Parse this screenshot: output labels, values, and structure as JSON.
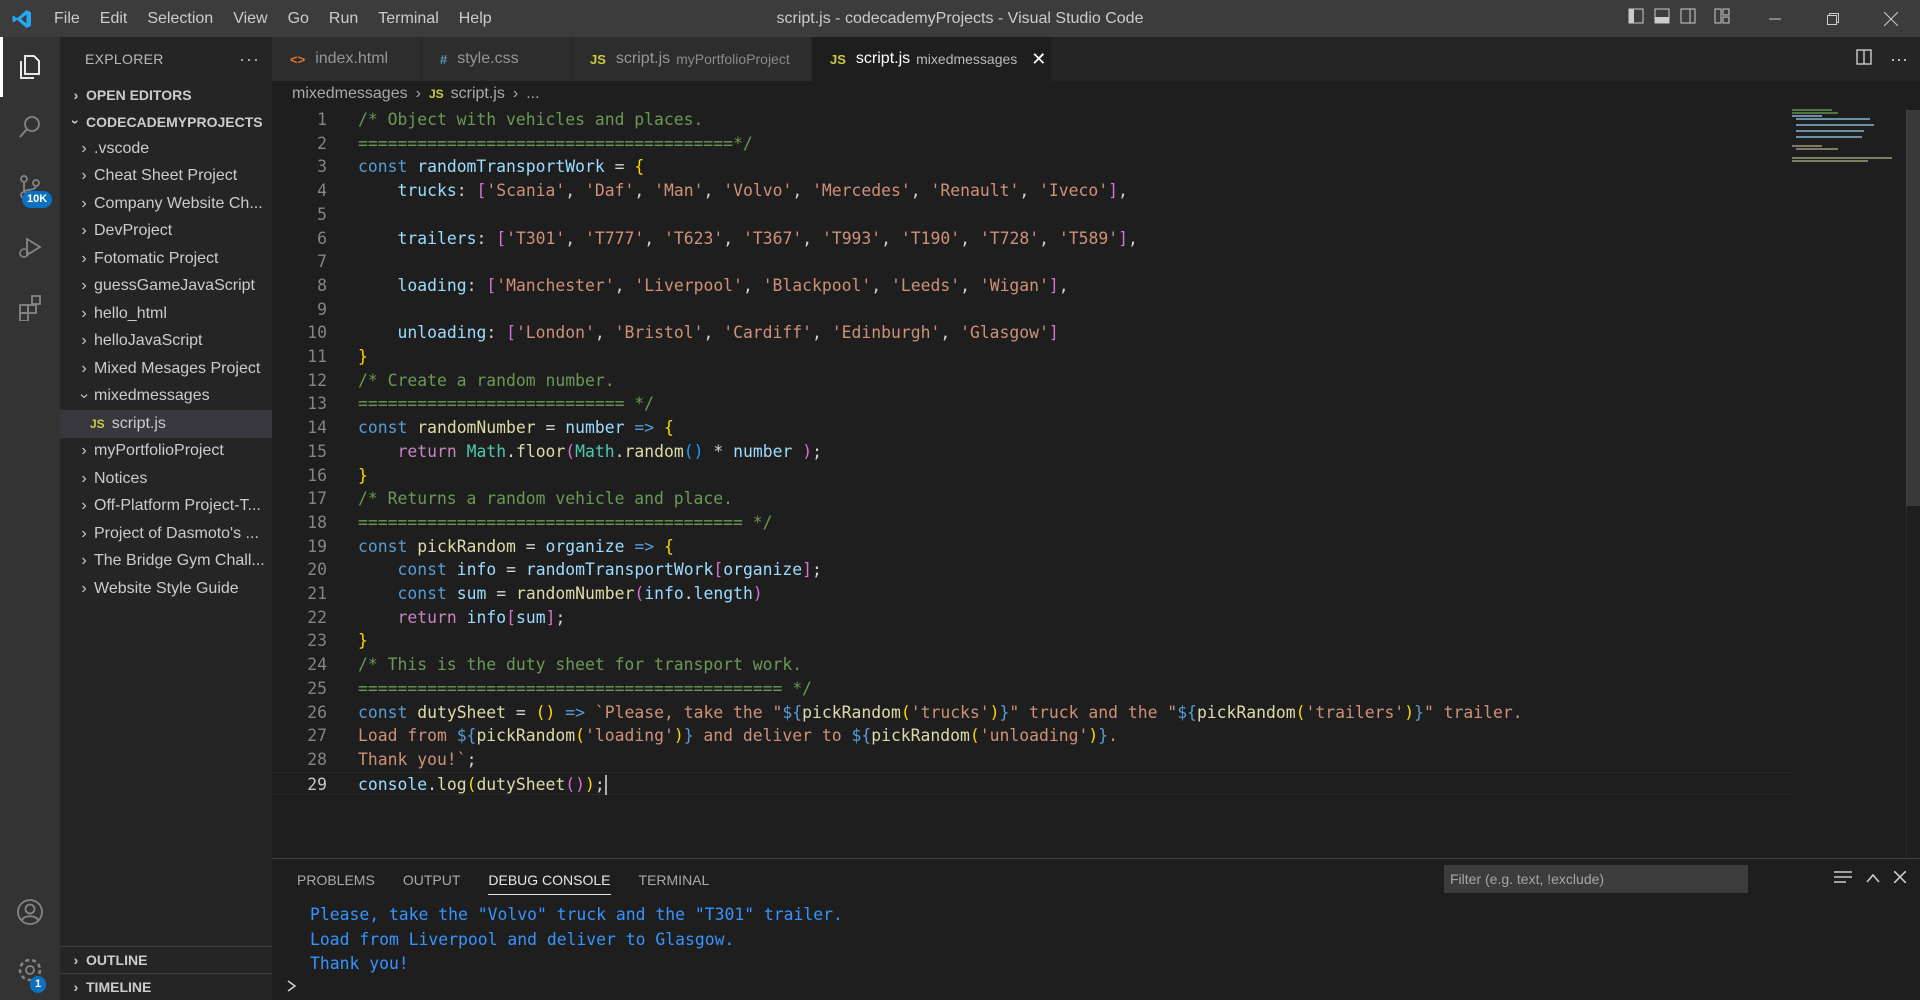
{
  "window": {
    "title": "script.js - codecademyProjects - Visual Studio Code"
  },
  "menu": [
    "File",
    "Edit",
    "Selection",
    "View",
    "Go",
    "Run",
    "Terminal",
    "Help"
  ],
  "activity": {
    "scm_badge": "10K",
    "settings_badge": "1"
  },
  "sidebar": {
    "title": "EXPLORER",
    "open_editors": "OPEN EDITORS",
    "root": "CODECADEMYPROJECTS",
    "items": [
      {
        "label": ".vscode",
        "type": "folder"
      },
      {
        "label": "Cheat Sheet Project",
        "type": "folder"
      },
      {
        "label": "Company Website Ch...",
        "type": "folder"
      },
      {
        "label": "DevProject",
        "type": "folder"
      },
      {
        "label": "Fotomatic Project",
        "type": "folder"
      },
      {
        "label": "guessGameJavaScript",
        "type": "folder"
      },
      {
        "label": "hello_html",
        "type": "folder"
      },
      {
        "label": "helloJavaScript",
        "type": "folder"
      },
      {
        "label": "Mixed Mesages Project",
        "type": "folder"
      },
      {
        "label": "mixedmessages",
        "type": "folder-open"
      },
      {
        "label": "script.js",
        "type": "file"
      },
      {
        "label": "myPortfolioProject",
        "type": "folder"
      },
      {
        "label": "Notices",
        "type": "folder"
      },
      {
        "label": "Off-Platform Project-T...",
        "type": "folder"
      },
      {
        "label": "Project of Dasmoto's ...",
        "type": "folder"
      },
      {
        "label": "The Bridge Gym Chall...",
        "type": "folder"
      },
      {
        "label": "Website Style Guide",
        "type": "folder"
      }
    ],
    "outline": "OUTLINE",
    "timeline": "TIMELINE"
  },
  "tabs": [
    {
      "label": "index.html",
      "desc": "",
      "icon": "<>",
      "icon_color": "#e37933"
    },
    {
      "label": "style.css",
      "desc": "",
      "icon": "#",
      "icon_color": "#519aba"
    },
    {
      "label": "script.js",
      "desc": "myPortfolioProject",
      "icon": "JS",
      "icon_color": "#cbcb41"
    },
    {
      "label": "script.js",
      "desc": "mixedmessages",
      "icon": "JS",
      "icon_color": "#cbcb41"
    }
  ],
  "breadcrumb": {
    "folder": "mixedmessages",
    "file": "script.js",
    "more": "..."
  },
  "editor": {
    "current_line": 29,
    "lines": [
      "/* Object with vehicles and places.",
      "======================================*/",
      "const randomTransportWork = {",
      "    trucks: ['Scania', 'Daf', 'Man', 'Volvo', 'Mercedes', 'Renault', 'Iveco'],",
      "",
      "    trailers: ['T301', 'T777', 'T623', 'T367', 'T993', 'T190', 'T728', 'T589'],",
      "",
      "    loading: ['Manchester', 'Liverpool', 'Blackpool', 'Leeds', 'Wigan'],",
      "",
      "    unloading: ['London', 'Bristol', 'Cardiff', 'Edinburgh', 'Glasgow']",
      "}",
      "/* Create a random number.",
      "=========================== */",
      "const randomNumber = number => {",
      "    return Math.floor(Math.random() * number );",
      "}",
      "/* Returns a random vehicle and place.",
      "======================================= */",
      "const pickRandom = organize => {",
      "    const info = randomTransportWork[organize];",
      "    const sum = randomNumber(info.length)",
      "    return info[sum];",
      "}",
      "/* This is the duty sheet for transport work.",
      "=========================================== */",
      "const dutySheet = () => `Please, take the \"${pickRandom('trucks')}\" truck and the \"${pickRandom('trailers')}\" trailer.",
      "Load from ${pickRandom('loading')} and deliver to ${pickRandom('unloading')}.",
      "Thank you!`;",
      "console.log(dutySheet());"
    ]
  },
  "panel": {
    "tabs": [
      "PROBLEMS",
      "OUTPUT",
      "DEBUG CONSOLE",
      "TERMINAL"
    ],
    "active_tab": "DEBUG CONSOLE",
    "filter_placeholder": "Filter (e.g. text, !exclude)",
    "output": [
      "Please, take the \"Volvo\" truck and the \"T301\" trailer.",
      "Load from Liverpool and deliver to Glasgow.",
      "Thank you!"
    ]
  }
}
